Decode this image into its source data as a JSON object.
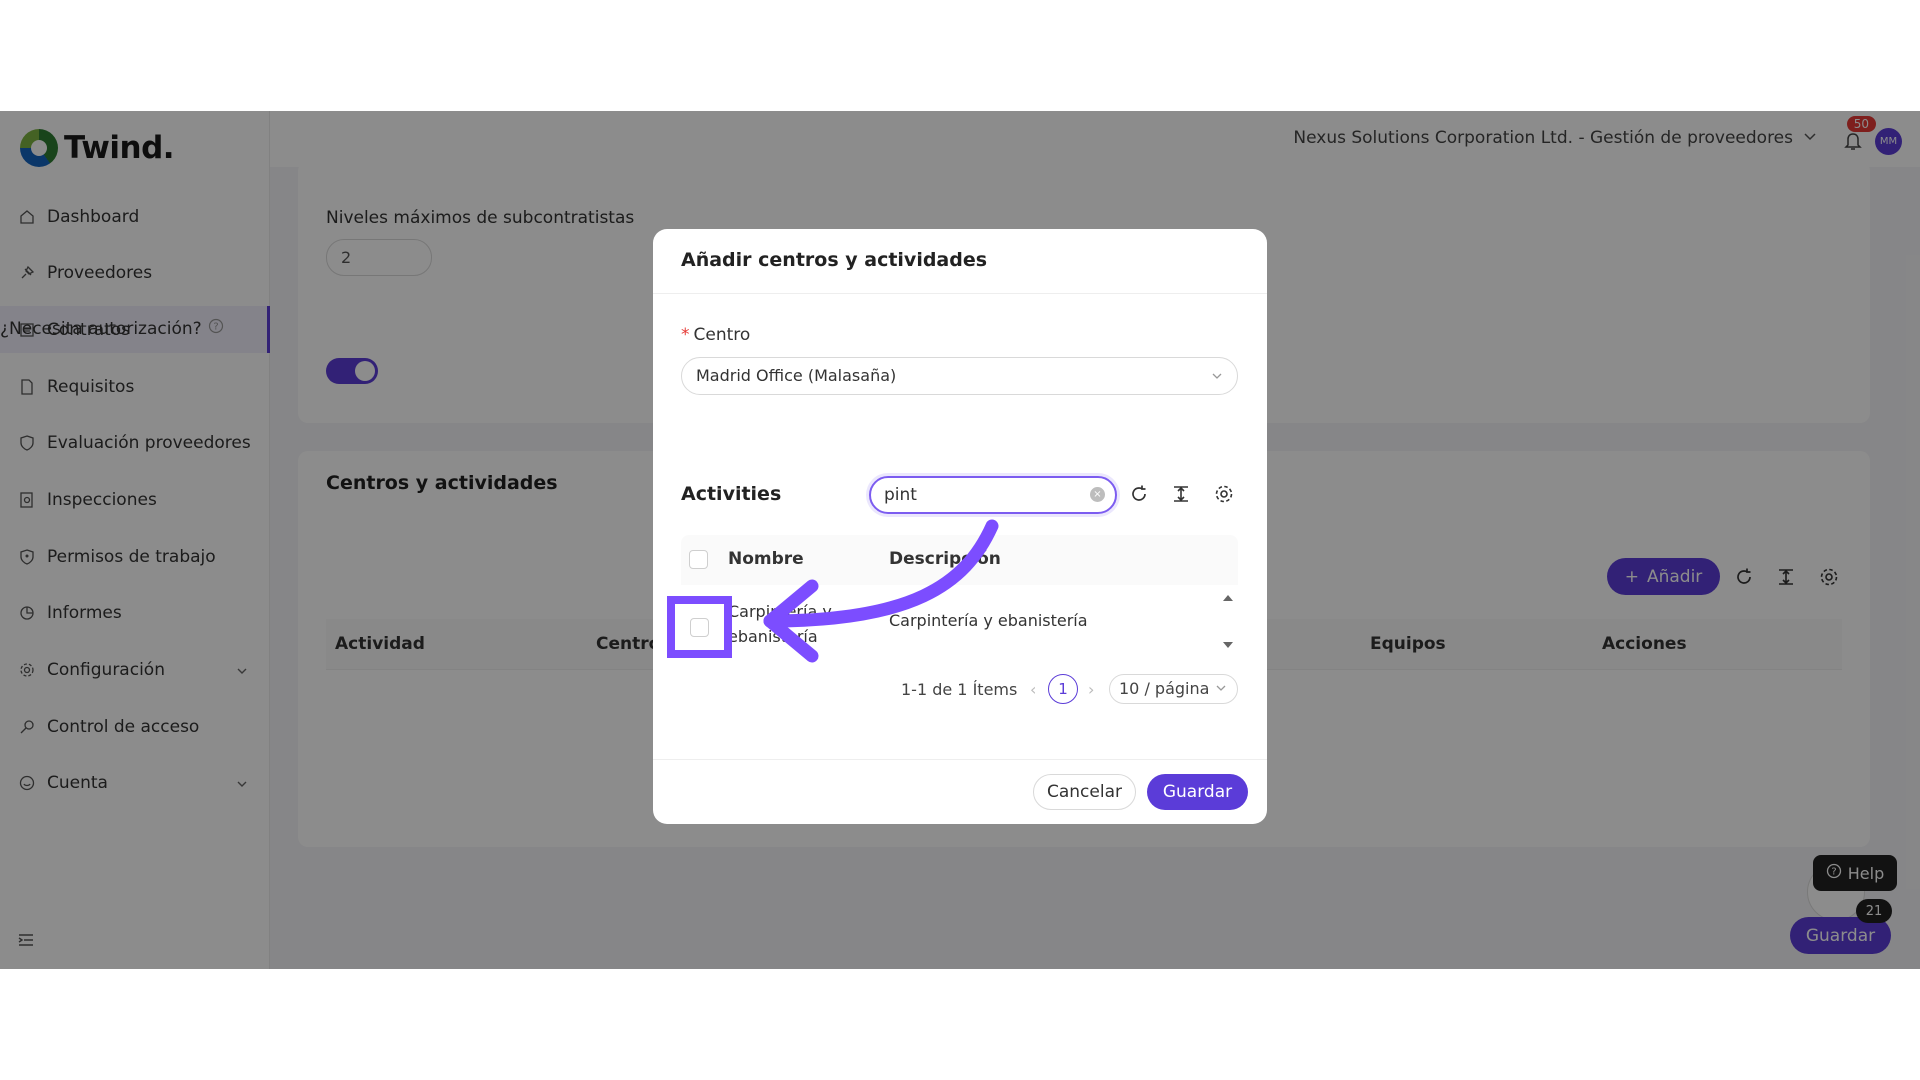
{
  "app": {
    "logo_text": "Twind."
  },
  "sidebar": {
    "items": [
      {
        "label": "Dashboard",
        "icon": "home-icon"
      },
      {
        "label": "Proveedores",
        "icon": "pin-icon"
      },
      {
        "label": "Contratos",
        "icon": "contract-icon",
        "active": true
      },
      {
        "label": "Requisitos",
        "icon": "document-icon"
      },
      {
        "label": "Evaluación proveedores",
        "icon": "shield-icon"
      },
      {
        "label": "Inspecciones",
        "icon": "inspection-icon"
      },
      {
        "label": "Permisos de trabajo",
        "icon": "permit-icon"
      },
      {
        "label": "Informes",
        "icon": "pie-icon"
      },
      {
        "label": "Configuración",
        "icon": "gear-icon",
        "expandable": true
      },
      {
        "label": "Control de acceso",
        "icon": "key-icon"
      },
      {
        "label": "Cuenta",
        "icon": "account-icon",
        "expandable": true
      }
    ]
  },
  "header": {
    "company": "Nexus Solutions Corporation Ltd. - Gestión de proveedores",
    "notifications": "50",
    "avatar_initials": "MM"
  },
  "background": {
    "niveles_label": "Niveles máximos de subcontratistas",
    "niveles_value": "2",
    "autorizacion_label": "¿Necesita autorización?",
    "section_title": "Centros y actividades",
    "add_button": "Añadir",
    "columns": [
      "Actividad",
      "Centro",
      "Equipos",
      "Acciones"
    ],
    "save_button": "Guardar",
    "help_label": "Help",
    "help_count": "21"
  },
  "modal": {
    "title": "Añadir centros y actividades",
    "centro_label": "Centro",
    "centro_value": "Madrid Office (Malasaña)",
    "activities_title": "Activities",
    "search_value": "pint",
    "columns": {
      "nombre": "Nombre",
      "descripcion": "Descripción"
    },
    "rows": [
      {
        "nombre": "Carpintería y ebanistería",
        "descripcion": "Carpintería y ebanistería"
      }
    ],
    "pagination": {
      "info": "1-1 de 1 Ítems",
      "page": "1",
      "page_size": "10 / página"
    },
    "cancel_button": "Cancelar",
    "save_button": "Guardar"
  },
  "colors": {
    "accent": "#5b3cd8",
    "highlight": "#7c4dff",
    "badge": "#e53935"
  }
}
